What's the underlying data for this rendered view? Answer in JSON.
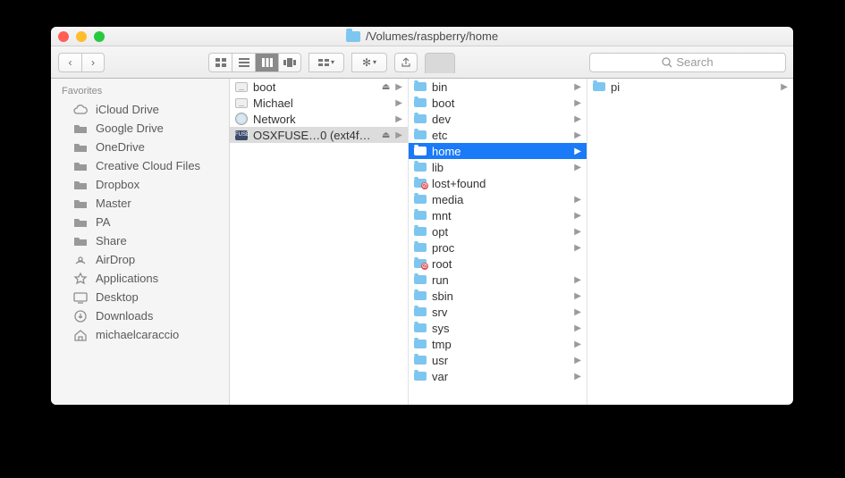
{
  "window": {
    "title": "/Volumes/raspberry/home"
  },
  "toolbar": {
    "search_placeholder": "Search"
  },
  "sidebar": {
    "section": "Favorites",
    "items": [
      {
        "label": "iCloud Drive",
        "icon": "cloud"
      },
      {
        "label": "Google Drive",
        "icon": "folder"
      },
      {
        "label": "OneDrive",
        "icon": "folder"
      },
      {
        "label": "Creative Cloud Files",
        "icon": "folder"
      },
      {
        "label": "Dropbox",
        "icon": "folder"
      },
      {
        "label": "Master",
        "icon": "folder"
      },
      {
        "label": "PA",
        "icon": "folder"
      },
      {
        "label": "Share",
        "icon": "folder"
      },
      {
        "label": "AirDrop",
        "icon": "airdrop"
      },
      {
        "label": "Applications",
        "icon": "apps"
      },
      {
        "label": "Desktop",
        "icon": "desktop"
      },
      {
        "label": "Downloads",
        "icon": "downloads"
      },
      {
        "label": "michaelcaraccio",
        "icon": "home"
      }
    ]
  },
  "columns": [
    {
      "items": [
        {
          "label": "boot",
          "icon": "disk",
          "eject": true,
          "arrow": true
        },
        {
          "label": "Michael",
          "icon": "disk",
          "arrow": true
        },
        {
          "label": "Network",
          "icon": "globe",
          "arrow": true
        },
        {
          "label": "OSXFUSE…0 (ext4fuse)",
          "icon": "fuse",
          "eject": true,
          "arrow": true,
          "selected": "gray"
        }
      ]
    },
    {
      "items": [
        {
          "label": "bin",
          "icon": "folder",
          "arrow": true
        },
        {
          "label": "boot",
          "icon": "folder",
          "arrow": true
        },
        {
          "label": "dev",
          "icon": "folder",
          "arrow": true
        },
        {
          "label": "etc",
          "icon": "folder",
          "arrow": true
        },
        {
          "label": "home",
          "icon": "folder",
          "arrow": true,
          "selected": "blue"
        },
        {
          "label": "lib",
          "icon": "folder",
          "arrow": true
        },
        {
          "label": "lost+found",
          "icon": "folder-warn"
        },
        {
          "label": "media",
          "icon": "folder",
          "arrow": true
        },
        {
          "label": "mnt",
          "icon": "folder",
          "arrow": true
        },
        {
          "label": "opt",
          "icon": "folder",
          "arrow": true
        },
        {
          "label": "proc",
          "icon": "folder",
          "arrow": true
        },
        {
          "label": "root",
          "icon": "folder-warn"
        },
        {
          "label": "run",
          "icon": "folder",
          "arrow": true
        },
        {
          "label": "sbin",
          "icon": "folder",
          "arrow": true
        },
        {
          "label": "srv",
          "icon": "folder",
          "arrow": true
        },
        {
          "label": "sys",
          "icon": "folder",
          "arrow": true
        },
        {
          "label": "tmp",
          "icon": "folder",
          "arrow": true
        },
        {
          "label": "usr",
          "icon": "folder",
          "arrow": true
        },
        {
          "label": "var",
          "icon": "folder",
          "arrow": true
        }
      ]
    },
    {
      "items": [
        {
          "label": "pi",
          "icon": "folder",
          "arrow": true
        }
      ]
    }
  ]
}
